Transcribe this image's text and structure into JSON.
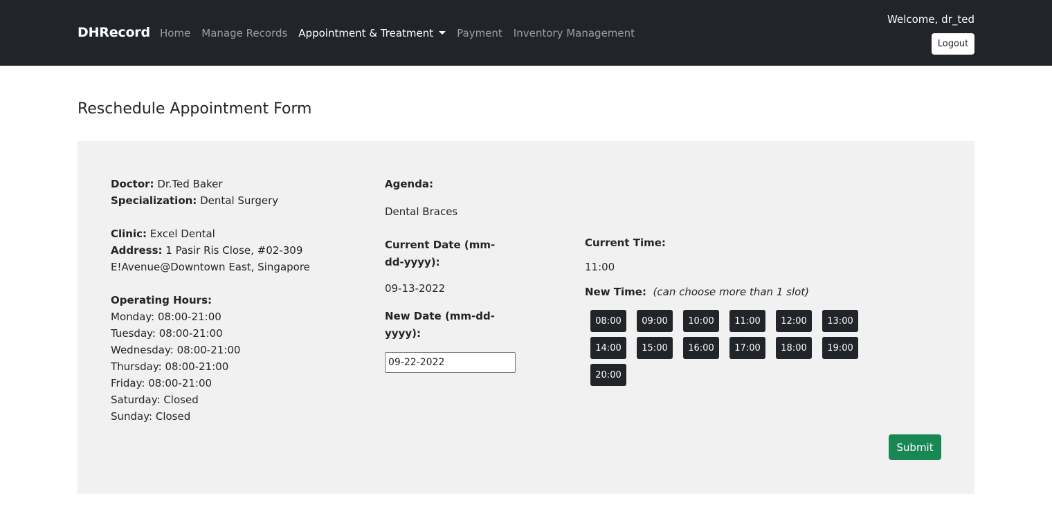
{
  "navbar": {
    "brand": "DHRecord",
    "links": [
      {
        "label": "Home"
      },
      {
        "label": "Manage Records"
      },
      {
        "label": "Appointment & Treatment"
      },
      {
        "label": "Payment"
      },
      {
        "label": "Inventory Management"
      }
    ],
    "welcome": "Welcome, dr_ted",
    "logout_label": "Logout"
  },
  "page": {
    "title": "Reschedule Appointment Form"
  },
  "doctor_info": {
    "doctor_label": "Doctor:",
    "doctor": "Dr.Ted Baker",
    "specialization_label": "Specialization:",
    "specialization": "Dental Surgery",
    "clinic_label": "Clinic:",
    "clinic": "Excel Dental",
    "address_label": "Address:",
    "address_line1": "1 Pasir Ris Close, #02-309",
    "address_line2": "E!Avenue@Downtown East, Singapore",
    "hours_label": "Operating Hours:",
    "hours": [
      "Monday: 08:00-21:00",
      "Tuesday: 08:00-21:00",
      "Wednesday: 08:00-21:00",
      "Thursday: 08:00-21:00",
      "Friday: 08:00-21:00",
      "Saturday: Closed",
      "Sunday: Closed"
    ]
  },
  "appointment": {
    "agenda_label": "Agenda:",
    "agenda": "Dental Braces",
    "current_date_label": "Current Date (mm-dd-yyyy):",
    "current_date": "09-13-2022",
    "new_date_label": "New Date (mm-dd-yyyy):",
    "new_date_value": "09-22-2022",
    "current_time_label": "Current Time:",
    "current_time": "11:00",
    "new_time_label": "New Time:",
    "new_time_hint": "(can choose more than 1 slot)",
    "time_slots": [
      "08:00",
      "09:00",
      "10:00",
      "11:00",
      "12:00",
      "13:00",
      "14:00",
      "15:00",
      "16:00",
      "17:00",
      "18:00",
      "19:00",
      "20:00"
    ],
    "submit_label": "Submit"
  },
  "colors": {
    "navbar_bg": "#212529",
    "card_bg": "#f1f1f1",
    "slot_bg": "#212529",
    "submit_bg": "#198754"
  }
}
